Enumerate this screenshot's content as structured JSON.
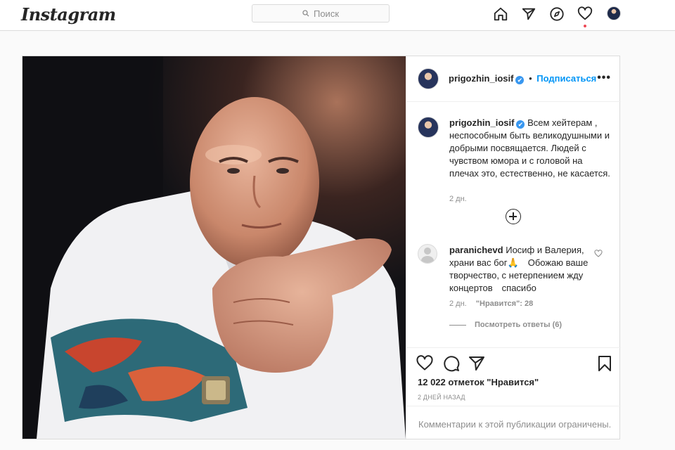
{
  "header": {
    "logo": "Instagram",
    "search_placeholder": "Поиск"
  },
  "post": {
    "author": "prigozhin_iosif",
    "verified_mark": "✔",
    "separator": "•",
    "follow_label": "Подписаться",
    "more_label": "•••",
    "caption_text": "Всем хейтерам , неспособным быть великодушными и добрыми посвящается. Людей с чувством юмора и с головой на плечах это, естественно, не касается.",
    "caption_time": "2 дн.",
    "comment": {
      "author": "paranichevd",
      "text": "Иосиф и Валерия, храни вас бог🙏 Обожаю ваше творчество, с нетерпением жду концертов спасибо",
      "time": "2 дн.",
      "likes": "\"Нравится\": 28",
      "view_replies": "Посмотреть ответы (6)"
    },
    "likes_count": "12 022 отметок \"Нравится\"",
    "posted_ago": "2 ДНЕЙ НАЗАД",
    "comments_restricted": "Комментарии к этой публикации ограничены."
  },
  "icons": {
    "home": "home-icon",
    "direct": "direct-icon",
    "explore": "compass-icon",
    "activity": "heart-icon",
    "like": "heart-icon",
    "comment": "comment-icon",
    "share": "share-icon",
    "save": "bookmark-icon"
  },
  "colors": {
    "accent": "#0095f6",
    "notification_dot": "#ed4956",
    "verified": "#3897f0"
  }
}
